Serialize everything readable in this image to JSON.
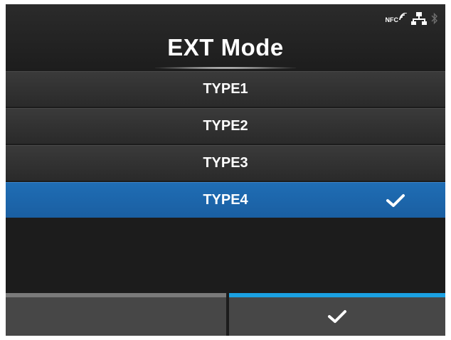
{
  "header": {
    "title": "EXT Mode",
    "status_icons": {
      "nfc_label": "NFC",
      "network": "network-icon",
      "bluetooth": "bluetooth-icon"
    }
  },
  "list": {
    "items": [
      {
        "label": "TYPE1",
        "selected": false
      },
      {
        "label": "TYPE2",
        "selected": false
      },
      {
        "label": "TYPE3",
        "selected": false
      },
      {
        "label": "TYPE4",
        "selected": true
      }
    ],
    "selected_icon": "checkmark-icon"
  },
  "footer": {
    "left_button": {
      "icon": null
    },
    "right_button": {
      "icon": "checkmark-icon"
    }
  },
  "colors": {
    "background": "#1c1c1c",
    "selected": "#1f6db4",
    "accent": "#1ba1e2",
    "footer_button": "#474747"
  }
}
